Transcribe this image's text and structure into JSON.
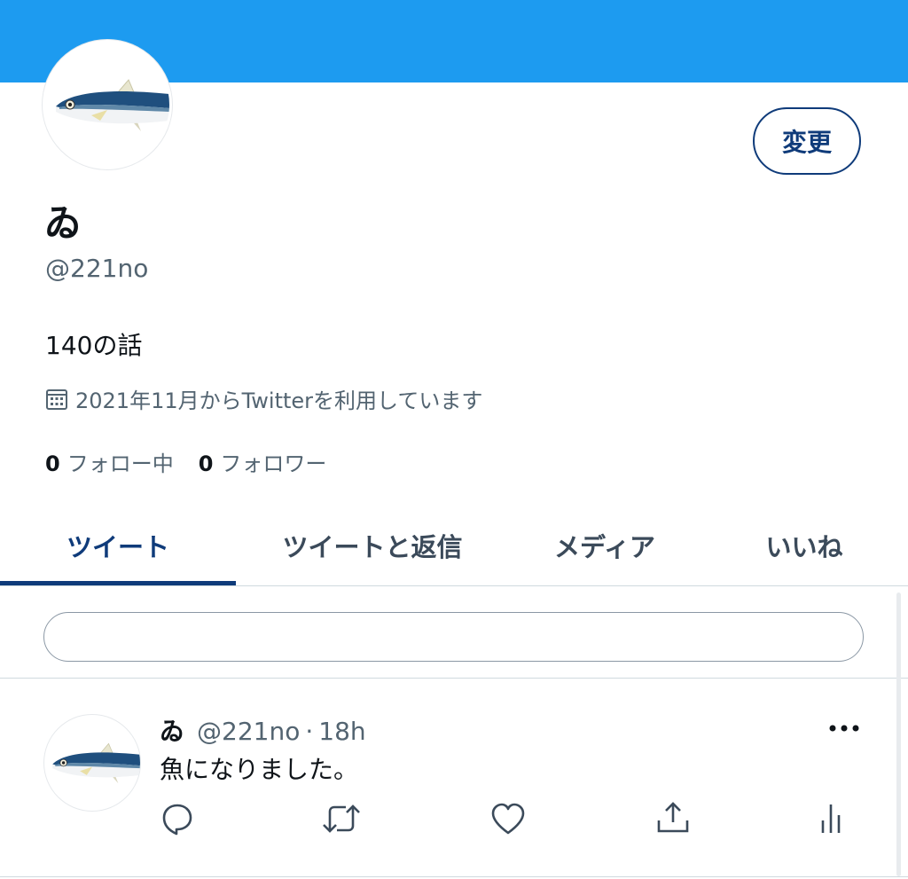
{
  "profile": {
    "display_name": "ゐ",
    "handle": "@221no",
    "bio": "140の話",
    "joined": "2021年11月からTwitterを利用しています",
    "following_count": "0",
    "following_label": "フォロー中",
    "followers_count": "0",
    "followers_label": "フォロワー",
    "edit_label": "変更"
  },
  "tabs": [
    {
      "label": "ツイート",
      "active": true
    },
    {
      "label": "ツイートと返信",
      "active": false
    },
    {
      "label": "メディア",
      "active": false
    },
    {
      "label": "いいね",
      "active": false
    }
  ],
  "compose": {
    "placeholder": ""
  },
  "tweet": {
    "name": "ゐ",
    "handle": "@221no",
    "separator": "·",
    "time": "18h",
    "text": "魚になりました。"
  },
  "colors": {
    "banner": "#1d9bf0",
    "accent": "#0f3b7a",
    "secondary_text": "#536471"
  },
  "icons": [
    "calendar-icon",
    "more-icon",
    "reply-icon",
    "retweet-icon",
    "like-icon",
    "share-icon",
    "analytics-icon"
  ]
}
